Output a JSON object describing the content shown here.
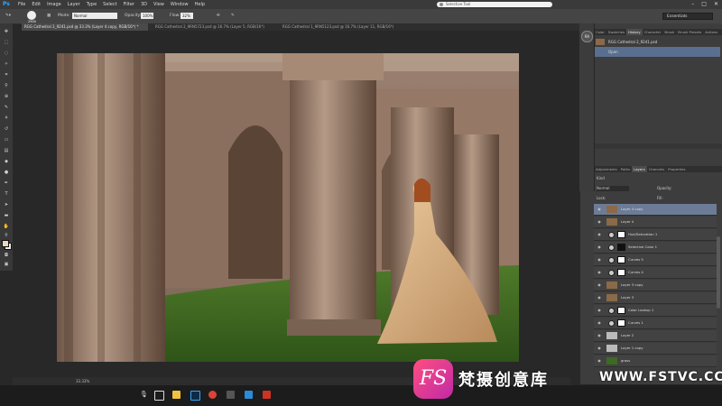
{
  "app": {
    "name": "Ps"
  },
  "menu": [
    "File",
    "Edit",
    "Image",
    "Layer",
    "Type",
    "Select",
    "Filter",
    "3D",
    "View",
    "Window",
    "Help"
  ],
  "search": {
    "placeholder": "Selective Tool"
  },
  "options": {
    "brush_size": "2900",
    "mode_label": "Mode:",
    "mode_value": "Normal",
    "opacity_label": "Opacity:",
    "opacity_value": "100%",
    "flow_label": "Flow:",
    "flow_value": "32%",
    "workspace": "Essentials"
  },
  "tabs": [
    {
      "label": "RGG Cathedral 2_9241.psd @ 33.3% (Layer 4 copy, RGB/16*) *"
    },
    {
      "label": "RGG Cathedral 2_9RN5723.psd @ 16.7% (Layer 5, RGB/16*)"
    },
    {
      "label": "RGG Cathedral 1_9RN5123.psd @ 16.7% (Layer 11, RGB/16*)"
    }
  ],
  "status": {
    "zoom": "33.33%"
  },
  "profile_badge": "RA",
  "history_panel": {
    "tabs": [
      "Color",
      "Swatches",
      "History",
      "Character",
      "Brush",
      "Brush Presets",
      "Actions"
    ],
    "active_tab": "History",
    "snapshot": "RGG Cathedral 2_9241.psd",
    "items": [
      "Open"
    ]
  },
  "layers_panel": {
    "tabs": [
      "Adjustments",
      "Paths",
      "Layers",
      "Channels",
      "Properties"
    ],
    "active_tab": "Layers",
    "kind_label": "Kind",
    "blend_mode": "Normal",
    "opacity_label": "Opacity:",
    "fill_label": "Fill:",
    "lock_label": "Lock:",
    "layers": [
      {
        "name": "Layer 4 copy",
        "type": "pixel",
        "selected": true
      },
      {
        "name": "Layer 4",
        "type": "pixel"
      },
      {
        "name": "Hue/Saturation 1",
        "type": "adjust"
      },
      {
        "name": "Selective Color 1",
        "type": "adjust"
      },
      {
        "name": "Curves 5",
        "type": "adjust"
      },
      {
        "name": "Curves 4",
        "type": "adjust"
      },
      {
        "name": "Layer 3 copy",
        "type": "pixel"
      },
      {
        "name": "Layer 3",
        "type": "pixel"
      },
      {
        "name": "Color Lookup 1",
        "type": "adjust"
      },
      {
        "name": "Curves 1",
        "type": "adjust"
      },
      {
        "name": "Layer 2",
        "type": "pixel"
      },
      {
        "name": "Layer 1 copy",
        "type": "pixel"
      },
      {
        "name": "grass",
        "type": "pixel"
      }
    ]
  },
  "watermark": {
    "logo_letters": "FS",
    "text": "梵摄创意库",
    "url": "WWW.FSTVC.CC"
  },
  "colors": {
    "accent": "#31a8ff",
    "selected_layer": "#6c7c97"
  }
}
